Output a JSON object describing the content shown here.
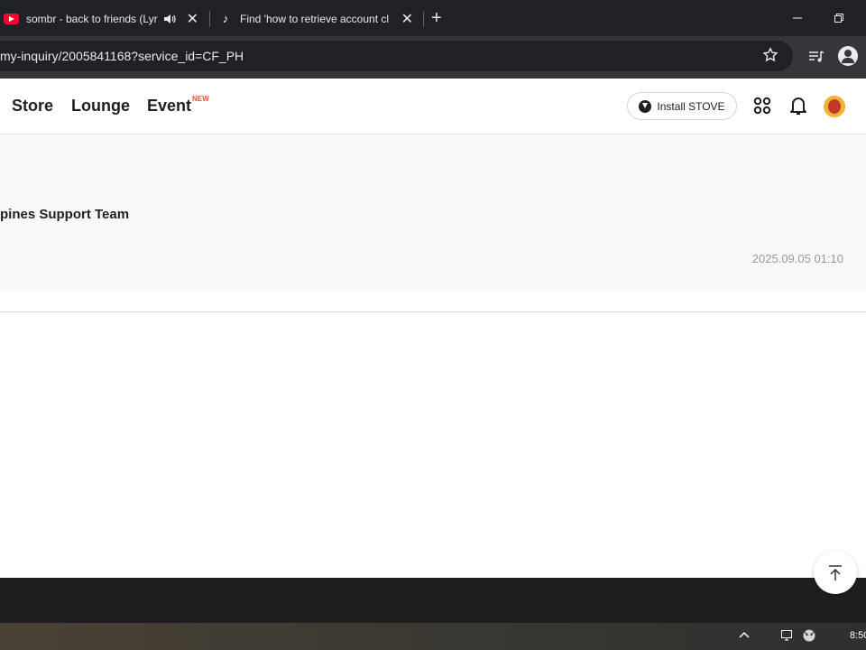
{
  "browser": {
    "tabs": [
      {
        "title": "sombr - back to friends (Lyr",
        "icon": "youtube-icon",
        "audio": true
      },
      {
        "title": "Find 'how to retrieve account cl",
        "icon": "tiktok-icon",
        "audio": false
      }
    ],
    "new_tab_label": "+",
    "url": "my-inquiry/2005841168?service_id=CF_PH"
  },
  "site": {
    "nav": {
      "store": "Store",
      "lounge": "Lounge",
      "event": "Event",
      "event_badge": "NEW"
    },
    "install_label": "Install STOVE"
  },
  "inquiry": {
    "support_team": "pines Support Team",
    "reply_date": "2025.09.05 01:10"
  },
  "taskbar": {
    "clock": "8:50"
  }
}
